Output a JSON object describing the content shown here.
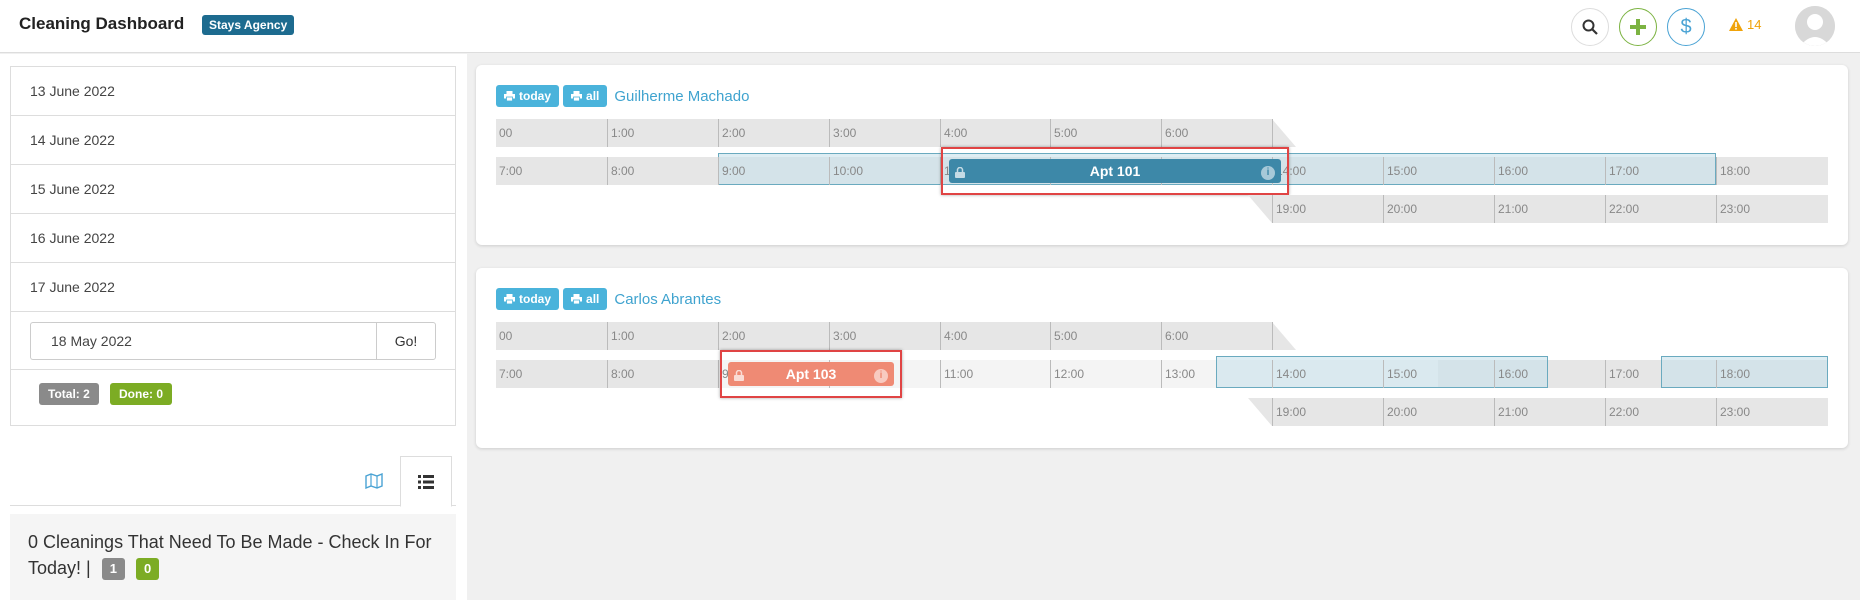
{
  "header": {
    "title": "Cleaning Dashboard",
    "agency": "Stays Agency",
    "alerts_count": "14",
    "dollar_symbol": "$"
  },
  "sidebar": {
    "dates": [
      "13 June 2022",
      "14 June 2022",
      "15 June 2022",
      "16 June 2022",
      "17 June 2022"
    ],
    "goto_date_value": "18 May 2022",
    "go_label": "Go!",
    "total_label": "Total: 2",
    "done_label": "Done: 0",
    "cleanings_text": "0 Cleanings That Need To Be Made - Check In For Today! |",
    "badge_gray": "1",
    "badge_green": "0"
  },
  "schedules": [
    {
      "today_label": "today",
      "all_label": "all",
      "cleaner": "Guilherme Machado",
      "booking": "Apt 101"
    },
    {
      "today_label": "today",
      "all_label": "all",
      "cleaner": "Carlos Abrantes",
      "booking": "Apt 103"
    }
  ],
  "timeline": {
    "row1": [
      "00",
      "1:00",
      "2:00",
      "3:00",
      "4:00",
      "5:00",
      "6:00"
    ],
    "row2": [
      "7:00",
      "8:00",
      "9:00",
      "10:00",
      "11:00",
      "12:00",
      "13:00",
      "14:00",
      "15:00",
      "16:00",
      "17:00",
      "18:00"
    ],
    "row3": [
      "19:00",
      "20:00",
      "21:00",
      "22:00",
      "23:00"
    ]
  },
  "colors": {
    "accent": "#4ab3db",
    "booking_blue": "#3d88a8",
    "booking_red": "#ef8a74",
    "highlight": "#e04444"
  }
}
